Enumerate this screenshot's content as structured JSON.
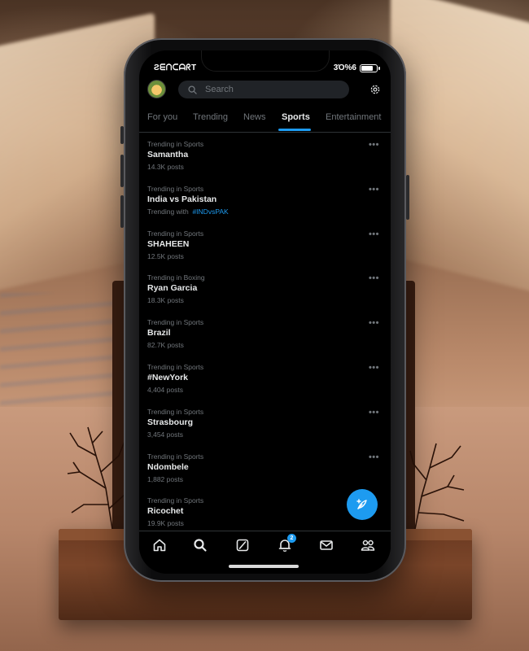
{
  "status_bar": {
    "left_text": "ƧᗴᑎᑕᗩᖇT",
    "right_text": "3Ό%6"
  },
  "search": {
    "placeholder": "Search"
  },
  "tabs": [
    {
      "label": "For you",
      "active": false
    },
    {
      "label": "Trending",
      "active": false
    },
    {
      "label": "News",
      "active": false
    },
    {
      "label": "Sports",
      "active": true
    },
    {
      "label": "Entertainment",
      "active": false
    }
  ],
  "trends": [
    {
      "context": "Trending in Sports",
      "name": "Samantha",
      "sub": "14.3K posts"
    },
    {
      "context": "Trending in Sports",
      "name": "India vs Pakistan",
      "sub_prefix": "Trending with",
      "sub_hashtag": "#INDvsPAK"
    },
    {
      "context": "Trending in Sports",
      "name": "SHAHEEN",
      "sub": "12.5K posts"
    },
    {
      "context": "Trending in Boxing",
      "name": "Ryan Garcia",
      "sub": "18.3K posts"
    },
    {
      "context": "Trending in Sports",
      "name": "Brazil",
      "sub": "82.7K posts"
    },
    {
      "context": "Trending in Sports",
      "name": "#NewYork",
      "sub": "4,404 posts"
    },
    {
      "context": "Trending in Sports",
      "name": "Strasbourg",
      "sub": "3,454 posts"
    },
    {
      "context": "Trending in Sports",
      "name": "Ndombele",
      "sub": "1,882 posts"
    },
    {
      "context": "Trending in Sports",
      "name": "Ricochet",
      "sub": "19.9K posts"
    }
  ],
  "more_label": "•••",
  "bottom_nav": {
    "items": [
      "home-icon",
      "search-icon",
      "grok-icon",
      "notifications-icon",
      "messages-icon",
      "communities-icon"
    ],
    "notification_badge": "2"
  },
  "colors": {
    "accent": "#1d9bf0",
    "background": "#000000",
    "muted": "#71767b",
    "text": "#e7e9ea"
  }
}
